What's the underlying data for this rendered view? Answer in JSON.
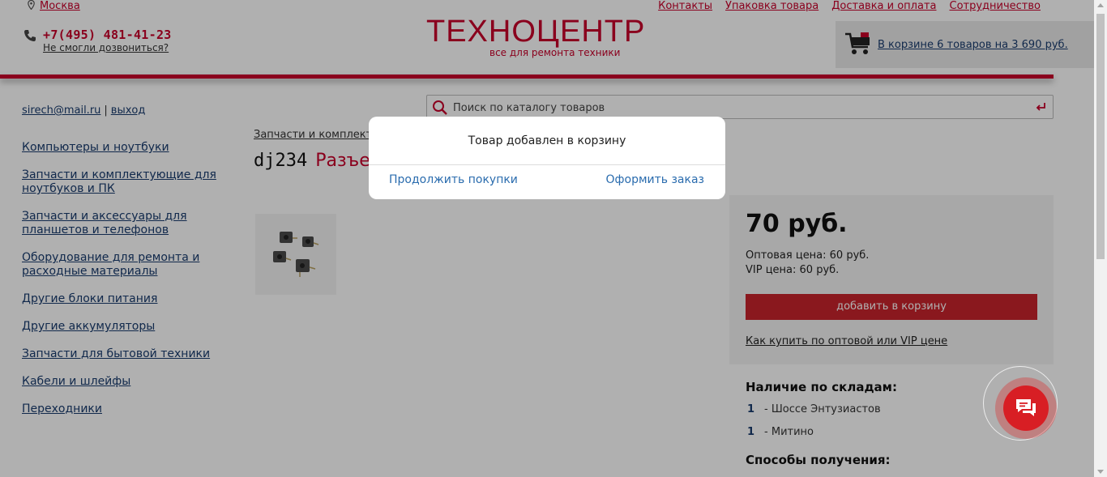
{
  "header": {
    "city": "Москва",
    "nav": [
      "Контакты",
      "Упаковка товара",
      "Доставка и оплата",
      "Сотрудничество"
    ],
    "phone": "+7(495) 481-41-23",
    "callback": "Не смогли дозвониться?",
    "logo": "ТЕХНОЦЕНТР",
    "tagline": "все для ремонта техники",
    "cart_text": "В корзине 6 товаров на 3 690 руб."
  },
  "user": {
    "email": "sirech@mail.ru",
    "separator": "|",
    "logout": "выход"
  },
  "search": {
    "placeholder": "Поиск по каталогу товаров"
  },
  "catalog": [
    "Компьютеры и ноутбуки",
    "Запчасти и комплектующие для ноутбуков и ПК",
    "Запчасти и аксессуары для планшетов и телефонов",
    "Оборудование для ремонта и расходные материалы",
    "Другие блоки питания",
    "Другие аккумуляторы",
    "Запчасти для бытовой техники",
    "Кабели и шлейфы",
    "Переходники"
  ],
  "product": {
    "breadcrumb": "Запчасти и комплектующие",
    "sku": "dj234",
    "name": "Разъем",
    "price": "70 руб.",
    "wholesale": "Оптовая цена: 60 руб.",
    "vip": "VIP цена: 60 руб.",
    "add_button": "добавить в корзину",
    "how_to_buy": "Как купить по оптовой или VIP цене"
  },
  "stock": {
    "title": "Наличие по складам:",
    "items": [
      {
        "qty": "1",
        "place": "- Шоссе Энтузиастов"
      },
      {
        "qty": "1",
        "place": "- Митино"
      }
    ],
    "delivery_title": "Способы получения:"
  },
  "modal": {
    "title": "Товар добавлен в корзину",
    "continue": "Продолжить покупки",
    "checkout": "Оформить заказ"
  },
  "colors": {
    "brand_red": "#c8002a",
    "link_blue": "#1a3c6e",
    "modal_link": "#2a6cae"
  }
}
